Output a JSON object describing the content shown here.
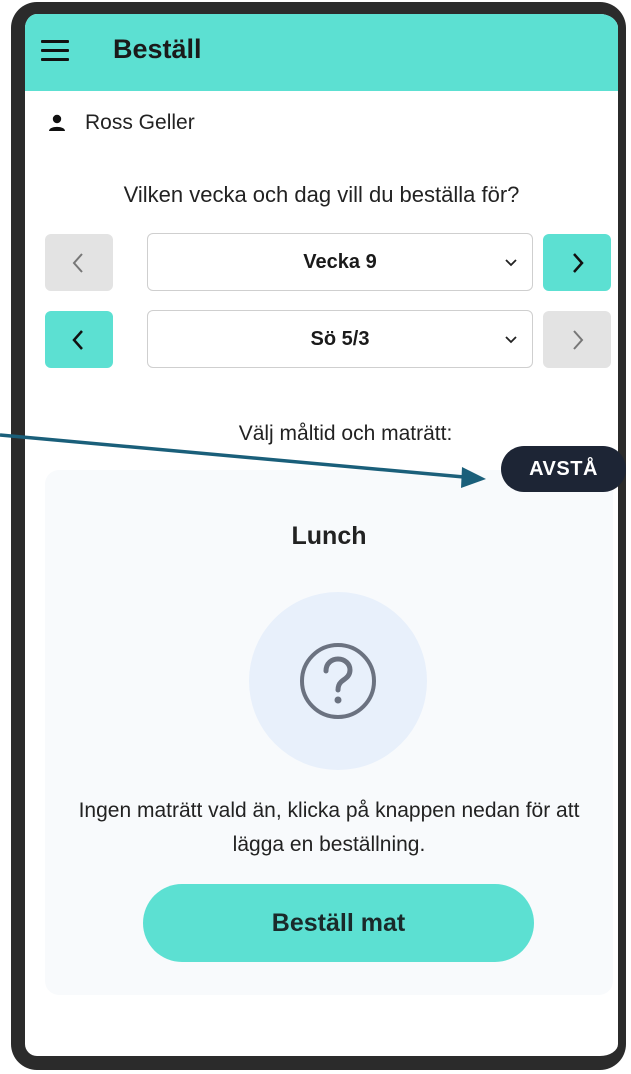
{
  "header": {
    "title": "Beställ",
    "menu_icon": "hamburger-menu-icon"
  },
  "user": {
    "name": "Ross Geller",
    "icon": "person-icon"
  },
  "selection": {
    "question": "Vilken vecka och dag vill du beställa för?",
    "week": {
      "value": "Vecka 9",
      "prev_enabled": false,
      "next_enabled": true
    },
    "day": {
      "value": "Sö 5/3",
      "prev_enabled": true,
      "next_enabled": false
    }
  },
  "meal": {
    "prompt": "Välj måltid och maträtt:",
    "title": "Lunch",
    "empty_icon": "question-mark-circle-icon",
    "empty_text": "Ingen maträtt vald än, klicka på knappen nedan för att lägga en beställning.",
    "order_button": "Beställ mat"
  },
  "annotation": {
    "label": "AVSTÅ"
  },
  "colors": {
    "accent": "#5ce0d2",
    "disabled": "#e3e3e3",
    "badge": "#1d2535",
    "arrow": "#1a5f7a"
  }
}
